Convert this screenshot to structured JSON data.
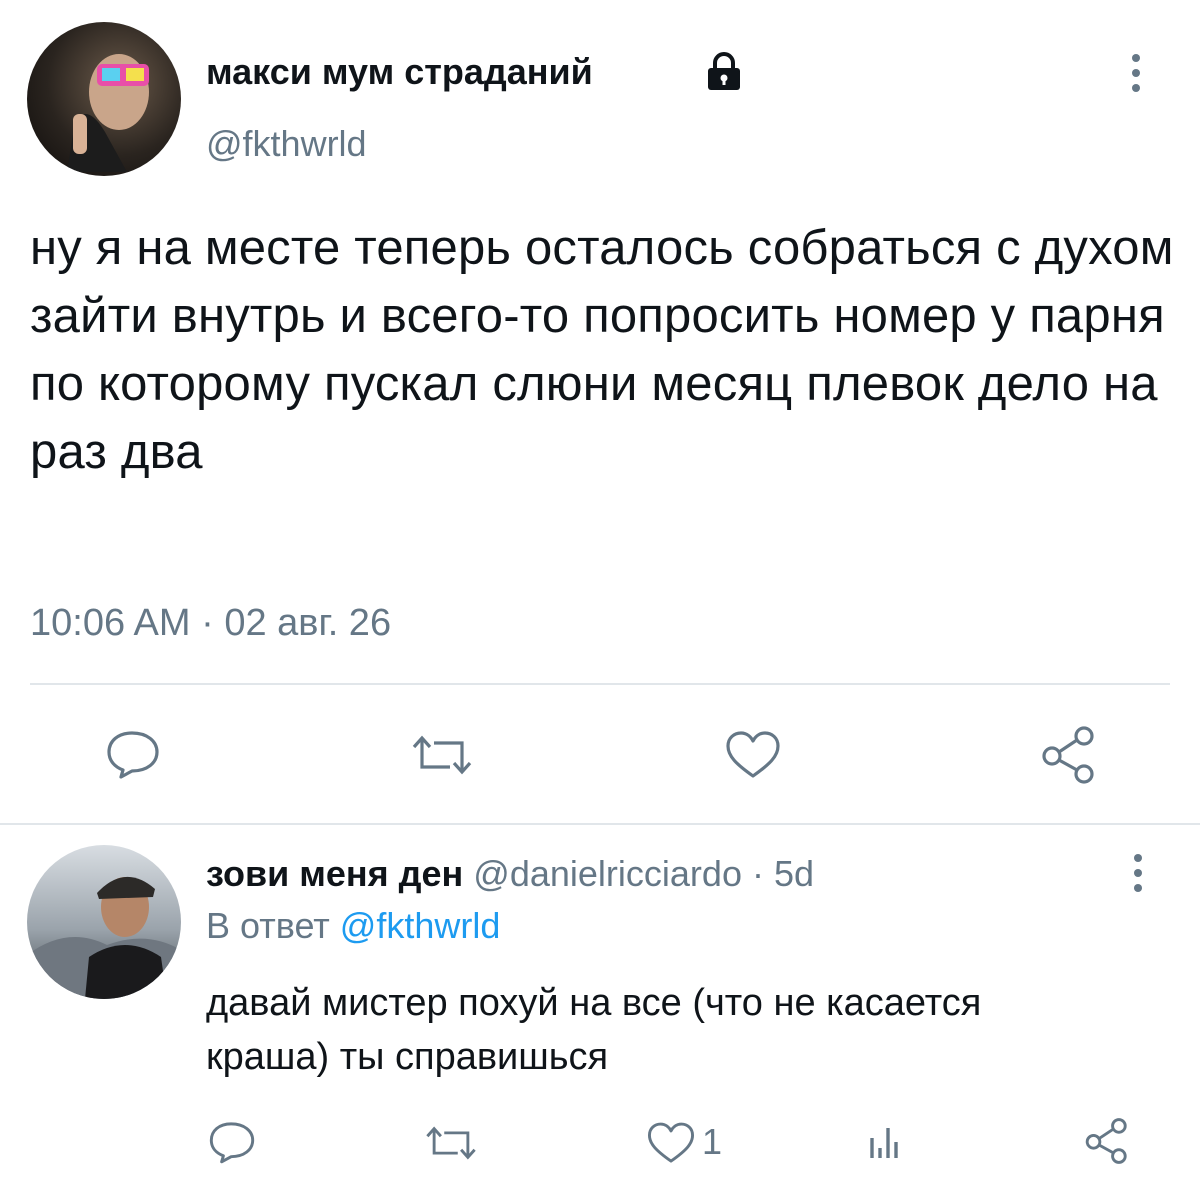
{
  "tweet": {
    "author": {
      "name": "макси мум страданий",
      "handle": "@fkthwrld",
      "lock_icon": "lock-icon"
    },
    "text": "ну я на месте теперь осталось собраться с духом зайти внутрь и всего-то попросить номер у парня по которому пускал слюни месяц плевок дело на раз два",
    "timestamp": "10:06 AM · 02 авг. 26",
    "actions": [
      "reply-icon",
      "retweet-icon",
      "like-icon",
      "share-icon"
    ]
  },
  "reply": {
    "author": {
      "name": "зови меня ден",
      "handle": "@danielricciardo",
      "age": "· 5d"
    },
    "in_reply_prefix": "В ответ",
    "in_reply_handle": "@fkthwrld",
    "text": "давай мистер похуй на все (что не касается краша) ты справишься",
    "like_count": "1",
    "actions": [
      "reply-icon",
      "retweet-icon",
      "like-icon",
      "analytics-icon",
      "share-icon"
    ]
  },
  "colors": {
    "text": "#0f1419",
    "muted": "#657786",
    "link": "#1d9bf0",
    "divider": "#e1e6ea"
  }
}
